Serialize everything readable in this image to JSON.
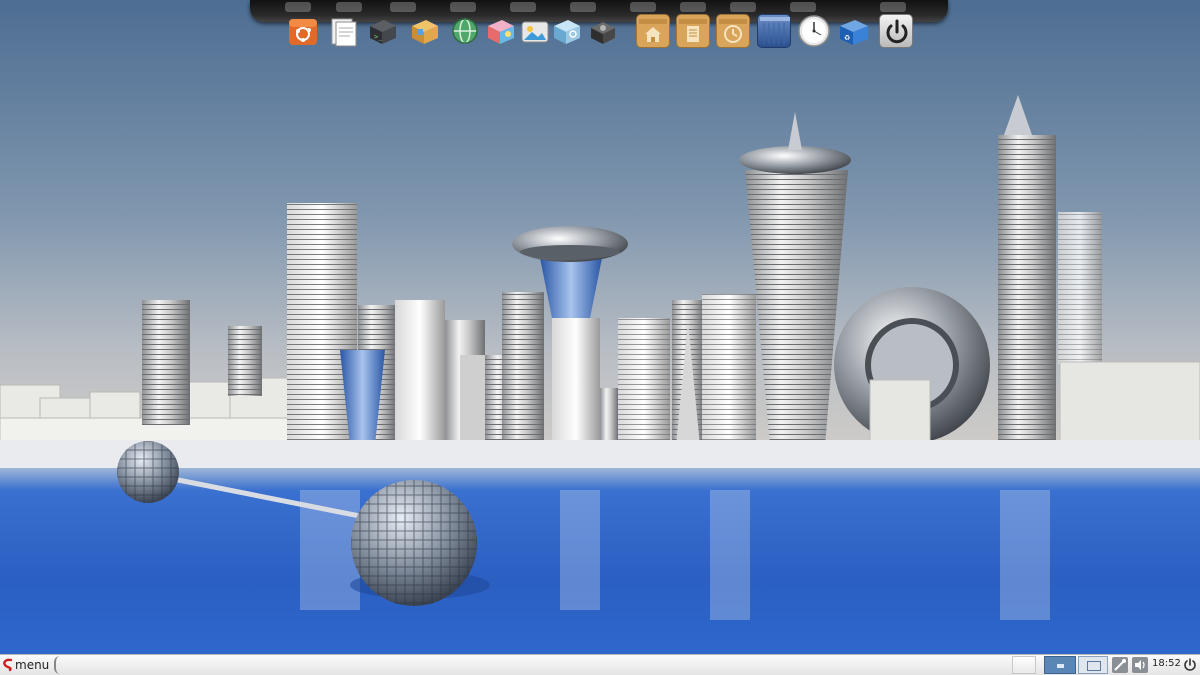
{
  "taskbar": {
    "menu_label": "menu",
    "clock": "18:52"
  },
  "dock": {
    "icons": [
      {
        "name": "ubuntu-software-icon"
      },
      {
        "name": "files-icon"
      },
      {
        "name": "terminal-icon"
      },
      {
        "name": "package-icon"
      },
      {
        "name": "network-globe-icon"
      },
      {
        "name": "compiz-cube-icon"
      },
      {
        "name": "photos-icon"
      },
      {
        "name": "settings-cube-icon"
      },
      {
        "name": "hardware-icon"
      },
      {
        "name": "home-folder-icon"
      },
      {
        "name": "documents-folder-icon"
      },
      {
        "name": "recent-folder-icon"
      },
      {
        "name": "desktop-icon"
      },
      {
        "name": "clock-icon"
      },
      {
        "name": "trash-icon"
      },
      {
        "name": "power-icon"
      }
    ]
  },
  "colors": {
    "sky_top": "#4e6f95",
    "sky_horizon": "#c4c6c9",
    "water": "#2f63c4",
    "taskbar": "#f0f0f0",
    "folder": "#d9a55a"
  }
}
